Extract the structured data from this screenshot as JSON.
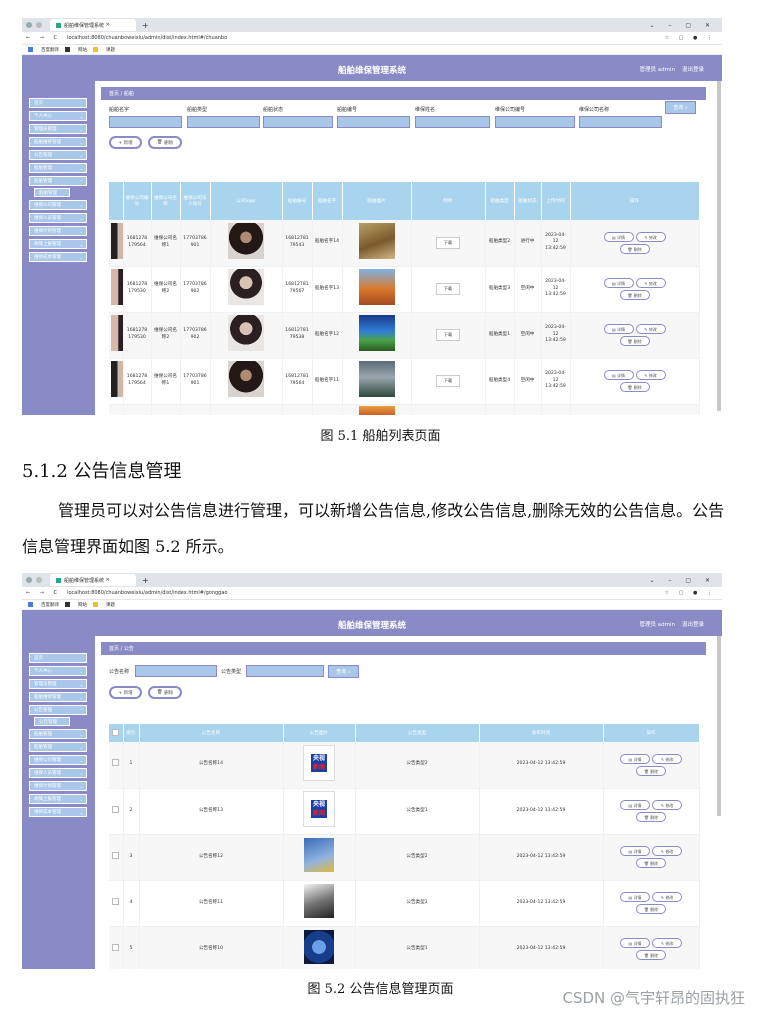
{
  "colors": {
    "header": "#8a8bc6",
    "table_head": "#a9d4ee",
    "input": "#a9c7e9"
  },
  "browser1": {
    "tab_title": "船舶维保管理系统",
    "url": "localhost:8080/chuanboweixiu/admin/dist/index.html#/chuanbo",
    "bookmarks": [
      "百度翻译",
      "网站",
      "课题"
    ]
  },
  "browser2": {
    "tab_title": "船舶维保管理系统",
    "url": "localhost:8080/chuanboweixiu/admin/dist/index.html#/gonggao",
    "bookmarks": [
      "百度翻译",
      "网站",
      "课题"
    ]
  },
  "app": {
    "title": "船舶维保管理系统",
    "user_label": "管理员 admin",
    "logout": "退出登录"
  },
  "sidebar1": {
    "items": [
      "首页",
      "个人中心",
      "管理员管理",
      "船舶维修管理",
      "公告管理",
      "船舶管理",
      "船舶管理",
      "维保公司管理",
      "维保人员管理",
      "维保计划管理",
      "故障上报管理",
      "维修成本管理"
    ],
    "sub": "船舶管理",
    "sub_after_index": 6
  },
  "sidebar2": {
    "items": [
      "首页",
      "个人中心",
      "管理员管理",
      "船舶维修管理",
      "公告管理",
      "船舶管理",
      "船舶管理",
      "维保公司管理",
      "维保人员管理",
      "维保计划管理",
      "故障上报管理",
      "维修成本管理"
    ],
    "sub": "公告管理",
    "sub_after_index": 4
  },
  "screen1": {
    "breadcrumb": "首页 / 船舶",
    "filters": [
      "船舶名字",
      "船舶类型",
      "船舶状态",
      "船舶编号",
      "维保姓名",
      "维保公司编号",
      "维保公司名称"
    ],
    "search_btn": "查询",
    "add_btn": "+ 新增",
    "delete_btn": "删除",
    "columns": [
      "",
      "维保公司编号",
      "维保公司名称",
      "维保公司法人账号",
      "公司logo",
      "船舶编号",
      "船舶名字",
      "船舶图片",
      "附件",
      "船舶类型",
      "船舶状态",
      "上传时间",
      "操作"
    ],
    "rows": [
      {
        "company_no": "1681278179564",
        "company_name": "维保公司名称1",
        "legal": "17703786901",
        "ship_no": "1681278179543",
        "ship_name": "船舶名字14",
        "download": "下载",
        "type": "船舶类型2",
        "status": "进行中",
        "time": "2023-04-12 13:42:59"
      },
      {
        "company_no": "1681278179530",
        "company_name": "维保公司名称2",
        "legal": "17703786902",
        "ship_no": "1681278179567",
        "ship_name": "船舶名字13",
        "download": "下载",
        "type": "船舶类型3",
        "status": "空闲中",
        "time": "2023-04-12 13:42:59"
      },
      {
        "company_no": "1681278179530",
        "company_name": "维保公司名称2",
        "legal": "17703786902",
        "ship_no": "1681278179538",
        "ship_name": "船舶名字12",
        "download": "下载",
        "type": "船舶类型1",
        "status": "空闲中",
        "time": "2023-04-12 13:42:59"
      },
      {
        "company_no": "1681278179564",
        "company_name": "维保公司名称1",
        "legal": "17703786901",
        "ship_no": "1681278179564",
        "ship_name": "船舶名字11",
        "download": "下载",
        "type": "船舶类型4",
        "status": "空闲中",
        "time": "2023-04-12 13:42:59"
      }
    ],
    "actions": [
      "详情",
      "修改",
      "删除"
    ]
  },
  "caption1": "图 5.1  船舶列表页面",
  "section_heading": "5.1.2  公告信息管理",
  "paragraph": "管理员可以对公告信息进行管理，可以新增公告信息,修改公告信息,删除无效的公告信息。公告信息管理界面如图 5.2 所示。",
  "screen2": {
    "breadcrumb": "首页 / 公告",
    "filter_name_label": "公告名称",
    "filter_type_label": "公告类型",
    "search_btn": "查询",
    "add_btn": "+ 新增",
    "delete_btn": "删除",
    "columns": [
      "",
      "索引",
      "公告名称",
      "公告图片",
      "公告类型",
      "发布时间",
      "操作"
    ],
    "rows": [
      {
        "idx": "1",
        "name": "公告名称14",
        "type": "公告类型2",
        "time": "2023-04-12 13:42:59"
      },
      {
        "idx": "2",
        "name": "公告名称13",
        "type": "公告类型1",
        "time": "2023-04-12 13:42:59"
      },
      {
        "idx": "3",
        "name": "公告名称12",
        "type": "公告类型2",
        "time": "2023-04-12 13:42:59"
      },
      {
        "idx": "4",
        "name": "公告名称11",
        "type": "公告类型2",
        "time": "2023-04-12 13:42:59"
      },
      {
        "idx": "5",
        "name": "公告名称10",
        "type": "公告类型1",
        "time": "2023-04-12 13:42:59"
      }
    ],
    "actions": [
      "详情",
      "修改",
      "删除"
    ],
    "cctv_top": "央视",
    "cctv_bottom": "新闻"
  },
  "caption2": "图 5.2  公告信息管理页面",
  "watermark": "CSDN @气宇轩昂的固执狂"
}
